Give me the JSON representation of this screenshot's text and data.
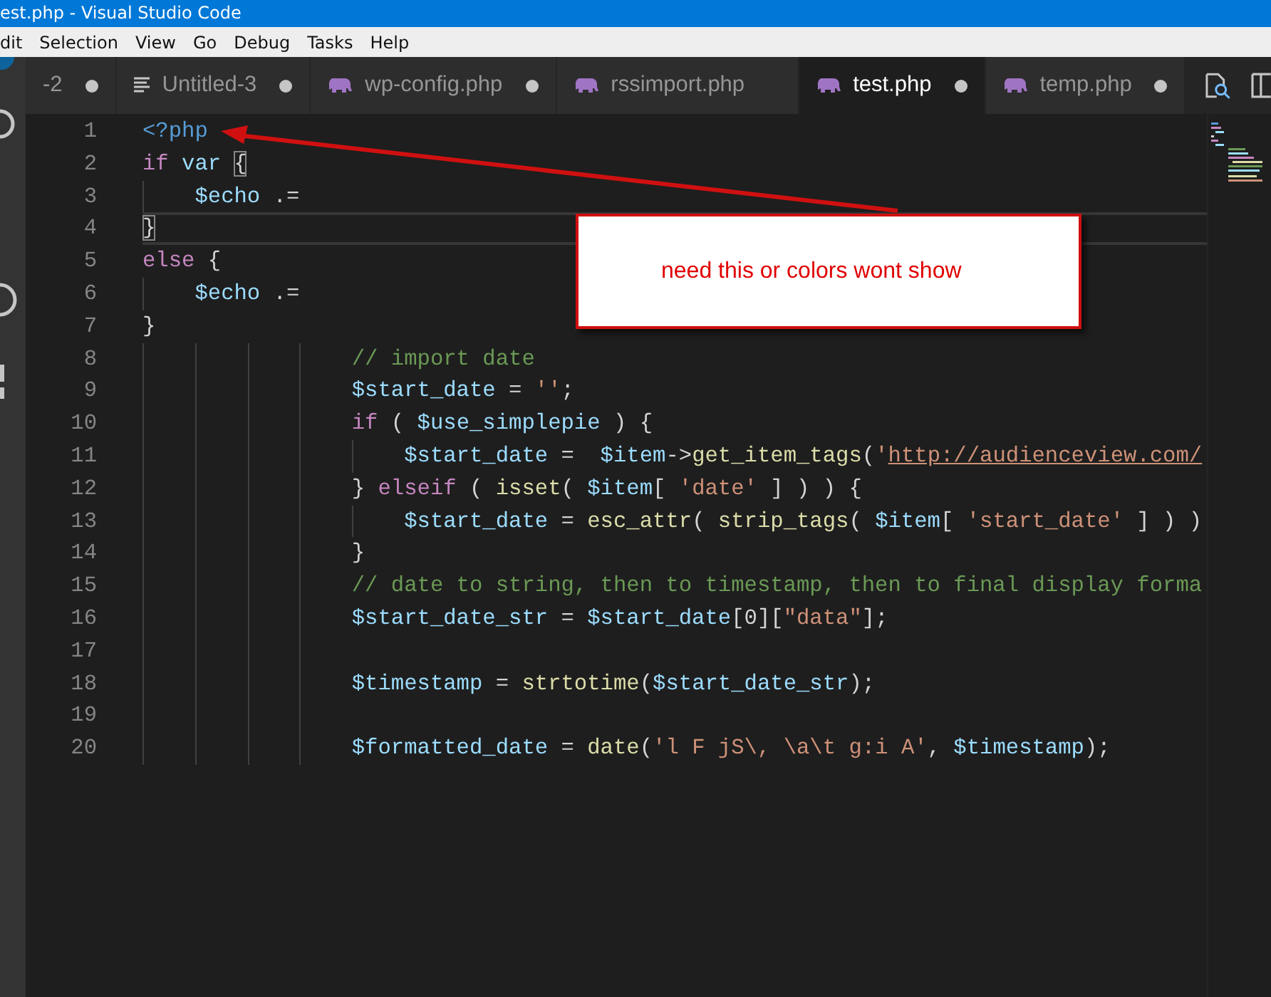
{
  "window": {
    "title": "est.php - Visual Studio Code"
  },
  "menu": [
    "dit",
    "Selection",
    "View",
    "Go",
    "Debug",
    "Tasks",
    "Help"
  ],
  "tabs": [
    {
      "label": "-2",
      "kind": "plain",
      "dirty": true,
      "selected": false
    },
    {
      "label": "Untitled-3",
      "kind": "text",
      "dirty": true,
      "selected": false
    },
    {
      "label": "wp-config.php",
      "kind": "php",
      "dirty": true,
      "selected": false
    },
    {
      "label": "rssimport.php",
      "kind": "php",
      "dirty": false,
      "selected": false
    },
    {
      "label": "test.php",
      "kind": "php",
      "dirty": true,
      "selected": true
    },
    {
      "label": "temp.php",
      "kind": "php",
      "dirty": true,
      "selected": false
    }
  ],
  "editor": {
    "lines": [
      {
        "number": "1",
        "current": false,
        "tokens": [
          {
            "kind": "tag",
            "text": "<?php"
          }
        ]
      },
      {
        "number": "2",
        "current": false,
        "tokens": [
          {
            "kind": "keyword",
            "text": "if "
          },
          {
            "kind": "variable",
            "text": "var "
          },
          {
            "kind": "bracket",
            "text": "{"
          }
        ]
      },
      {
        "number": "3",
        "current": false,
        "tokens": [
          {
            "kind": "variable",
            "text": "    $echo"
          },
          {
            "kind": "plain",
            "text": " .="
          }
        ]
      },
      {
        "number": "4",
        "current": true,
        "tokens": [
          {
            "kind": "bracket",
            "text": "}"
          }
        ]
      },
      {
        "number": "5",
        "current": false,
        "tokens": [
          {
            "kind": "keyword",
            "text": "else"
          },
          {
            "kind": "plain",
            "text": " {"
          }
        ]
      },
      {
        "number": "6",
        "current": false,
        "tokens": [
          {
            "kind": "variable",
            "text": "    $echo"
          },
          {
            "kind": "plain",
            "text": " .="
          }
        ]
      },
      {
        "number": "7",
        "current": false,
        "tokens": [
          {
            "kind": "plain",
            "text": "}"
          }
        ]
      },
      {
        "number": "8",
        "current": false,
        "tokens": [
          {
            "kind": "comment",
            "text": "                // import date"
          }
        ]
      },
      {
        "number": "9",
        "current": false,
        "tokens": [
          {
            "kind": "variable",
            "text": "                $start_date"
          },
          {
            "kind": "plain",
            "text": " = "
          },
          {
            "kind": "string",
            "text": "''"
          },
          {
            "kind": "plain",
            "text": ";"
          }
        ]
      },
      {
        "number": "10",
        "current": false,
        "tokens": [
          {
            "kind": "keyword",
            "text": "                if"
          },
          {
            "kind": "plain",
            "text": " ( "
          },
          {
            "kind": "variable",
            "text": "$use_simplepie"
          },
          {
            "kind": "plain",
            "text": " ) {"
          }
        ]
      },
      {
        "number": "11",
        "current": false,
        "tokens": [
          {
            "kind": "variable",
            "text": "                    $start_date"
          },
          {
            "kind": "plain",
            "text": " =  "
          },
          {
            "kind": "variable",
            "text": "$item"
          },
          {
            "kind": "plain",
            "text": "->"
          },
          {
            "kind": "function",
            "text": "get_item_tags"
          },
          {
            "kind": "plain",
            "text": "("
          },
          {
            "kind": "string",
            "text": "'"
          },
          {
            "kind": "link",
            "text": "http://audienceview.com/"
          }
        ]
      },
      {
        "number": "12",
        "current": false,
        "tokens": [
          {
            "kind": "plain",
            "text": "                } "
          },
          {
            "kind": "keyword",
            "text": "elseif"
          },
          {
            "kind": "plain",
            "text": " ( "
          },
          {
            "kind": "function",
            "text": "isset"
          },
          {
            "kind": "plain",
            "text": "( "
          },
          {
            "kind": "variable",
            "text": "$item"
          },
          {
            "kind": "plain",
            "text": "[ "
          },
          {
            "kind": "string",
            "text": "'date'"
          },
          {
            "kind": "plain",
            "text": " ] ) ) {"
          }
        ]
      },
      {
        "number": "13",
        "current": false,
        "tokens": [
          {
            "kind": "variable",
            "text": "                    $start_date"
          },
          {
            "kind": "plain",
            "text": " = "
          },
          {
            "kind": "function",
            "text": "esc_attr"
          },
          {
            "kind": "plain",
            "text": "( "
          },
          {
            "kind": "function",
            "text": "strip_tags"
          },
          {
            "kind": "plain",
            "text": "( "
          },
          {
            "kind": "variable",
            "text": "$item"
          },
          {
            "kind": "plain",
            "text": "[ "
          },
          {
            "kind": "string",
            "text": "'start_date'"
          },
          {
            "kind": "plain",
            "text": " ] ) )"
          }
        ]
      },
      {
        "number": "14",
        "current": false,
        "tokens": [
          {
            "kind": "plain",
            "text": "                }"
          }
        ]
      },
      {
        "number": "15",
        "current": false,
        "tokens": [
          {
            "kind": "comment",
            "text": "                // date to string, then to timestamp, then to final display forma"
          }
        ]
      },
      {
        "number": "16",
        "current": false,
        "tokens": [
          {
            "kind": "variable",
            "text": "                $start_date_str"
          },
          {
            "kind": "plain",
            "text": " = "
          },
          {
            "kind": "variable",
            "text": "$start_date"
          },
          {
            "kind": "plain",
            "text": "[0]["
          },
          {
            "kind": "string",
            "text": "\"data\""
          },
          {
            "kind": "plain",
            "text": "];"
          }
        ]
      },
      {
        "number": "17",
        "current": false
      },
      {
        "number": "18",
        "current": false,
        "tokens": [
          {
            "kind": "variable",
            "text": "                $timestamp"
          },
          {
            "kind": "plain",
            "text": " = "
          },
          {
            "kind": "function",
            "text": "strtotime"
          },
          {
            "kind": "plain",
            "text": "("
          },
          {
            "kind": "variable",
            "text": "$start_date_str"
          },
          {
            "kind": "plain",
            "text": ");"
          }
        ]
      },
      {
        "number": "19",
        "current": false
      },
      {
        "number": "20",
        "current": false,
        "tokens": [
          {
            "kind": "variable",
            "text": "                $formatted_date"
          },
          {
            "kind": "plain",
            "text": " = "
          },
          {
            "kind": "function",
            "text": "date"
          },
          {
            "kind": "plain",
            "text": "("
          },
          {
            "kind": "string",
            "text": "'l F jS\\, \\a\\t g:i A'"
          },
          {
            "kind": "plain",
            "text": ", "
          },
          {
            "kind": "variable",
            "text": "$timestamp"
          },
          {
            "kind": "plain",
            "text": ");"
          }
        ]
      }
    ]
  },
  "annotation": {
    "text": "need this or colors wont show"
  }
}
